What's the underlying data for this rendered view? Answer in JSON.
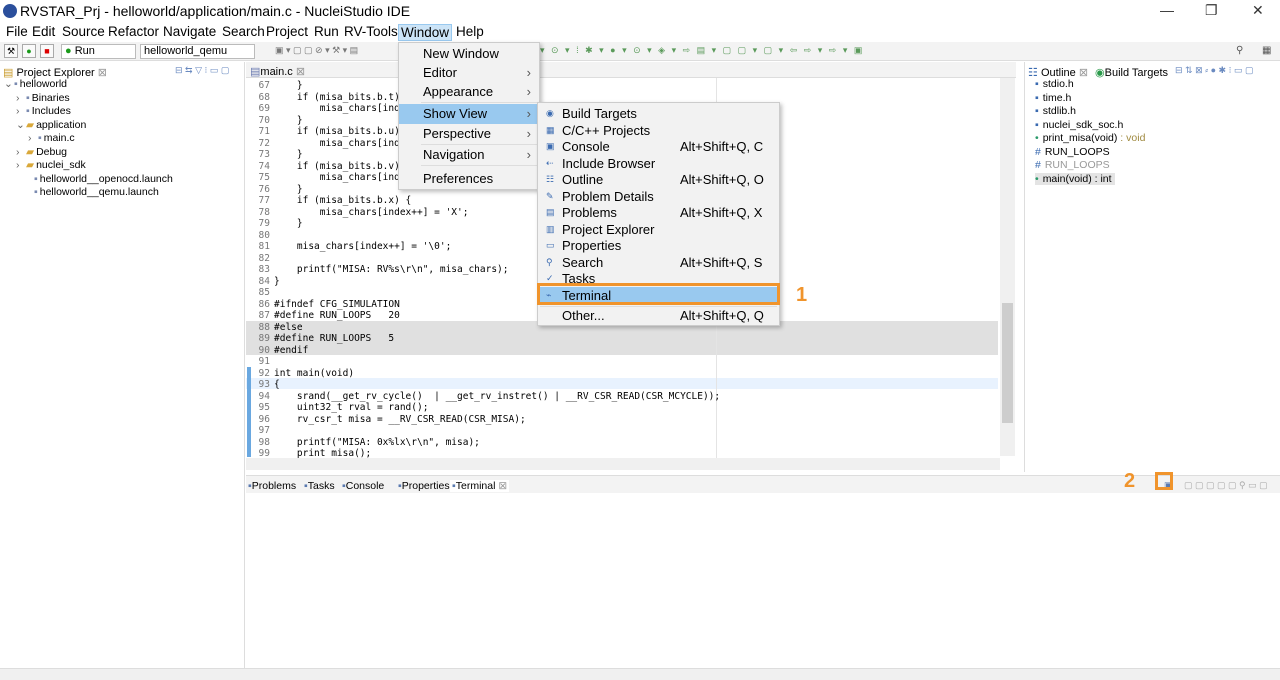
{
  "window": {
    "title": "RVSTAR_Prj - helloworld/application/main.c - NucleiStudio IDE",
    "controls": [
      "—",
      "❐",
      "✕"
    ]
  },
  "menubar": [
    "File",
    "Edit",
    "Source",
    "Refactor",
    "Navigate",
    "Search",
    "Project",
    "Run",
    "RV-Tools",
    "Window",
    "Help"
  ],
  "toolbar": {
    "run_config": "Run",
    "launch_target": "helloworld_qemu"
  },
  "project_explorer": {
    "title": "Project Explorer",
    "items": [
      {
        "label": "helloworld",
        "icon": "project-icon",
        "expander": "⌄"
      },
      {
        "label": "Binaries",
        "icon": "binaries-icon",
        "expander": "›"
      },
      {
        "label": "Includes",
        "icon": "includes-icon",
        "expander": "›"
      },
      {
        "label": "application",
        "icon": "folder-icon",
        "expander": "⌄"
      },
      {
        "label": "main.c",
        "icon": "c-file-icon",
        "expander": "›"
      },
      {
        "label": "Debug",
        "icon": "folder-icon",
        "expander": "›"
      },
      {
        "label": "nuclei_sdk",
        "icon": "folder-icon",
        "expander": "›"
      },
      {
        "label": "helloworld__openocd.launch",
        "icon": "launch-file-icon",
        "expander": ""
      },
      {
        "label": "helloworld__qemu.launch",
        "icon": "launch-file-icon",
        "expander": ""
      }
    ]
  },
  "editor": {
    "tab": "main.c",
    "lines": [
      {
        "n": "67",
        "c": "    }"
      },
      {
        "n": "68",
        "c": "    if (misa_bits.b.t)"
      },
      {
        "n": "69",
        "c": "        misa_chars[ind"
      },
      {
        "n": "70",
        "c": "    }"
      },
      {
        "n": "71",
        "c": "    if (misa_bits.b.u)"
      },
      {
        "n": "72",
        "c": "        misa_chars[ind"
      },
      {
        "n": "73",
        "c": "    }"
      },
      {
        "n": "74",
        "c": "    if (misa_bits.b.v)"
      },
      {
        "n": "75",
        "c": "        misa_chars[ind"
      },
      {
        "n": "76",
        "c": "    }"
      },
      {
        "n": "77",
        "c": "    if (misa_bits.b.x) {"
      },
      {
        "n": "78",
        "c": "        misa_chars[index++] = 'X';"
      },
      {
        "n": "79",
        "c": "    }"
      },
      {
        "n": "80",
        "c": ""
      },
      {
        "n": "81",
        "c": "    misa_chars[index++] = '\\0';"
      },
      {
        "n": "82",
        "c": ""
      },
      {
        "n": "83",
        "c": "    printf(\"MISA: RV%s\\r\\n\", misa_chars);"
      },
      {
        "n": "84",
        "c": "}"
      },
      {
        "n": "85",
        "c": ""
      },
      {
        "n": "86",
        "c": "#ifndef CFG_SIMULATION"
      },
      {
        "n": "87",
        "c": "#define RUN_LOOPS   20"
      },
      {
        "n": "88",
        "c": "#else"
      },
      {
        "n": "89",
        "c": "#define RUN_LOOPS   5"
      },
      {
        "n": "90",
        "c": "#endif"
      },
      {
        "n": "91",
        "c": ""
      },
      {
        "n": "92",
        "c": "int main(void)"
      },
      {
        "n": "93",
        "c": "{"
      },
      {
        "n": "94",
        "c": "    srand(__get_rv_cycle()  | __get_rv_instret() | __RV_CSR_READ(CSR_MCYCLE));"
      },
      {
        "n": "95",
        "c": "    uint32_t rval = rand();"
      },
      {
        "n": "96",
        "c": "    rv_csr_t misa = __RV_CSR_READ(CSR_MISA);"
      },
      {
        "n": "97",
        "c": ""
      },
      {
        "n": "98",
        "c": "    printf(\"MISA: 0x%lx\\r\\n\", misa);"
      },
      {
        "n": "99",
        "c": "    print_misa();"
      }
    ]
  },
  "outline": {
    "tabs": [
      "Outline",
      "Build Targets"
    ],
    "items": [
      {
        "label": "stdio.h",
        "suffix": ""
      },
      {
        "label": "time.h",
        "suffix": ""
      },
      {
        "label": "stdlib.h",
        "suffix": ""
      },
      {
        "label": "nuclei_sdk_soc.h",
        "suffix": ""
      },
      {
        "label": "print_misa(void)",
        "suffix": " : void"
      },
      {
        "label": "RUN_LOOPS",
        "suffix": ""
      },
      {
        "label": "RUN_LOOPS",
        "suffix": ""
      },
      {
        "label": "main(void) : int",
        "suffix": ""
      }
    ]
  },
  "window_menu": {
    "items": [
      {
        "label": "New Window",
        "sub": false
      },
      {
        "label": "Editor",
        "sub": true
      },
      {
        "label": "Appearance",
        "sub": true
      },
      {
        "label": "Show View",
        "sub": true,
        "active": true
      },
      {
        "label": "Perspective",
        "sub": true
      },
      {
        "label": "Navigation",
        "sub": true
      },
      {
        "label": "Preferences",
        "sub": false
      }
    ]
  },
  "show_view_menu": {
    "items": [
      {
        "label": "Build Targets",
        "shortcut": "",
        "icon": "◉"
      },
      {
        "label": "C/C++ Projects",
        "shortcut": "",
        "icon": "▦"
      },
      {
        "label": "Console",
        "shortcut": "Alt+Shift+Q, C",
        "icon": "▣"
      },
      {
        "label": "Include Browser",
        "shortcut": "",
        "icon": "⇠"
      },
      {
        "label": "Outline",
        "shortcut": "Alt+Shift+Q, O",
        "icon": "☷"
      },
      {
        "label": "Problem Details",
        "shortcut": "",
        "icon": "✎"
      },
      {
        "label": "Problems",
        "shortcut": "Alt+Shift+Q, X",
        "icon": "▤"
      },
      {
        "label": "Project Explorer",
        "shortcut": "",
        "icon": "▥"
      },
      {
        "label": "Properties",
        "shortcut": "",
        "icon": "▭"
      },
      {
        "label": "Search",
        "shortcut": "Alt+Shift+Q, S",
        "icon": "⚲"
      },
      {
        "label": "Tasks",
        "shortcut": "",
        "icon": "✓"
      },
      {
        "label": "Terminal",
        "shortcut": "",
        "icon": "⌁",
        "active": true
      }
    ],
    "other": {
      "label": "Other...",
      "shortcut": "Alt+Shift+Q, Q"
    }
  },
  "bottom_panel": {
    "tabs": [
      "Problems",
      "Tasks",
      "Console",
      "Properties",
      "Terminal"
    ],
    "active": "Terminal"
  },
  "annotations": [
    "1",
    "2"
  ],
  "colors": {
    "highlight": "#99c9ef",
    "annotation": "#f0942c",
    "keyword": "#7f0055"
  }
}
